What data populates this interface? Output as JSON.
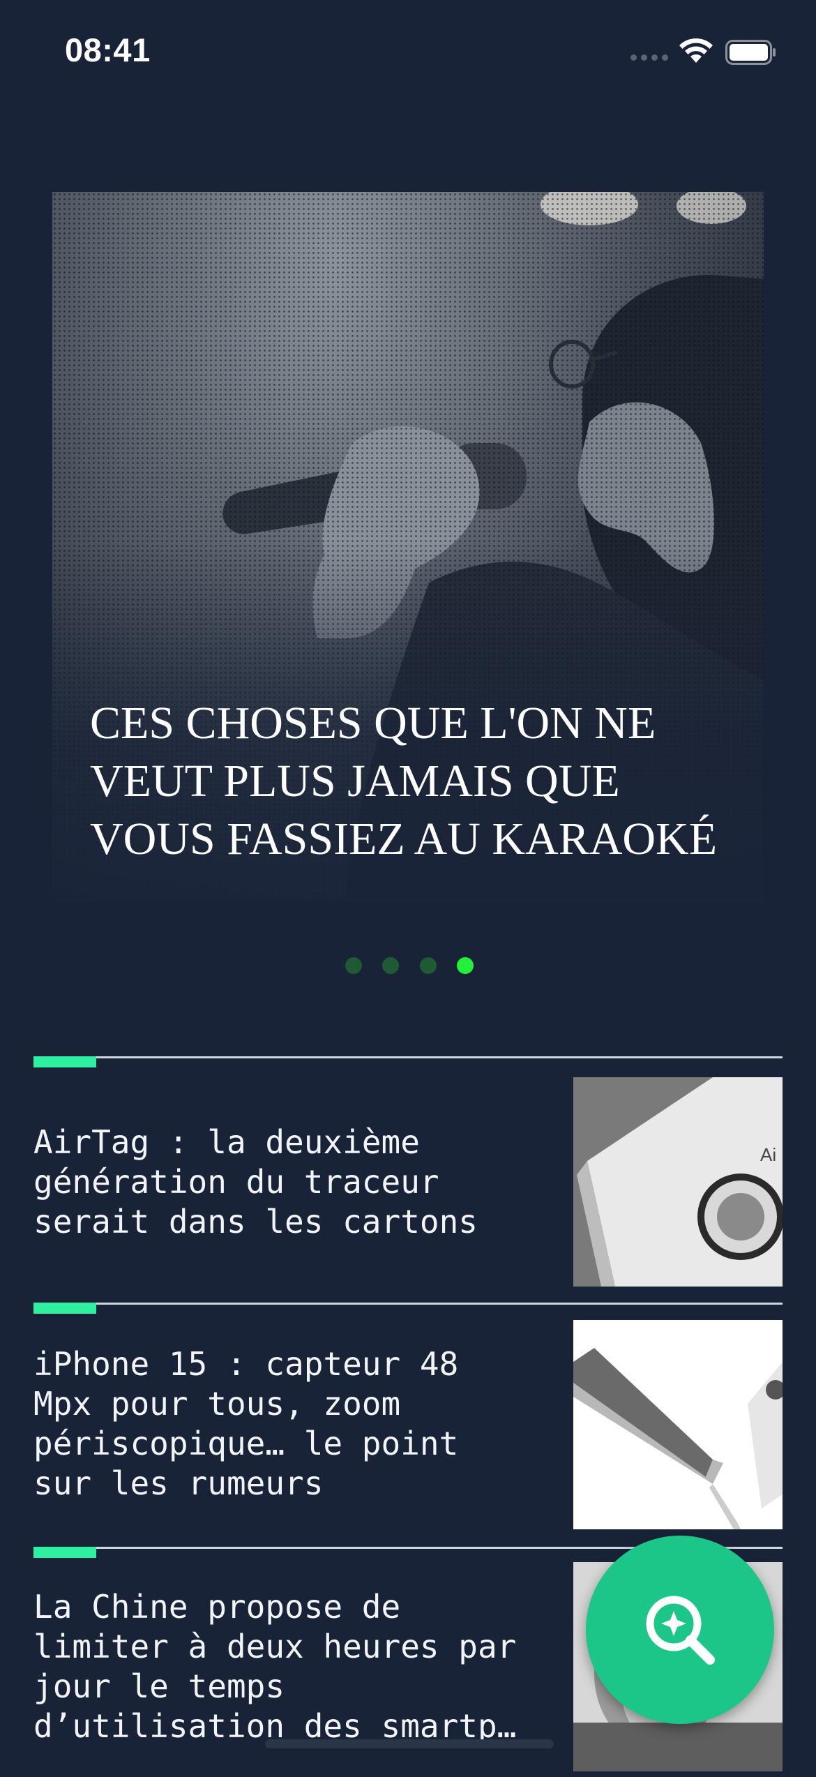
{
  "status_bar": {
    "time": "08:41",
    "icons": [
      "cellular-signal-icon",
      "wifi-icon",
      "battery-icon"
    ]
  },
  "hero": {
    "title": "CES CHOSES QUE L'ON NE VEUT PLUS JAMAIS QUE VOUS FASSIEZ AU KARAOKÉ",
    "image": "karaoke-singer-photo"
  },
  "pager": {
    "count": 4,
    "active_index": 3,
    "colors": {
      "inactive": "#1f5a35",
      "active": "#22f03a"
    }
  },
  "articles": [
    {
      "title": "AirTag : la deuxième\ngénération du traceur\nserait dans les cartons",
      "thumbnail": "airtag-box-photo"
    },
    {
      "title": "iPhone 15 : capteur 48\nMpx pour tous, zoom\npériscopique… le point\nsur les rumeurs",
      "thumbnail": "iphone-photo"
    },
    {
      "title": "La Chine propose de\nlimiter à deux heures par\njour le temps\nd’utilisation des smartp…",
      "thumbnail": "child-photo"
    }
  ],
  "fab": {
    "icon": "discover-search-icon"
  },
  "colors": {
    "background": "#192338",
    "accent": "#2ff0a0",
    "fab": "#1cc689",
    "text": "#f2f4f7"
  }
}
